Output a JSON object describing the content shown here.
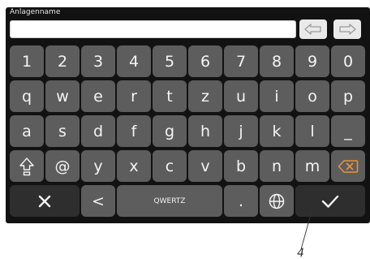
{
  "field": {
    "label": "Anlagenname",
    "value": "",
    "placeholder": ""
  },
  "keyboard": {
    "row_numbers": [
      "1",
      "2",
      "3",
      "4",
      "5",
      "6",
      "7",
      "8",
      "9",
      "0"
    ],
    "row_top": [
      "q",
      "w",
      "e",
      "r",
      "t",
      "z",
      "u",
      "i",
      "o",
      "p"
    ],
    "row_middle": [
      "a",
      "s",
      "d",
      "f",
      "g",
      "h",
      "j",
      "k",
      "l",
      "_"
    ],
    "row_bottom": [
      "@",
      "y",
      "x",
      "c",
      "v",
      "b",
      "n",
      "m"
    ],
    "less_than_label": "<",
    "layout_label": "QWERTZ",
    "dot_label": "."
  },
  "icons": {
    "cursor_left": "arrow-left-outline-icon",
    "cursor_right": "arrow-right-outline-icon",
    "shift": "shift-icon",
    "backspace": "backspace-icon",
    "cancel": "close-icon",
    "language": "globe-icon",
    "confirm": "checkmark-icon"
  },
  "colors": {
    "panel": "#121212",
    "key": "#5d5d5d",
    "key_dark": "#2e2e2e",
    "backspace_accent": "#e5933b"
  },
  "callout": {
    "number": "4"
  }
}
